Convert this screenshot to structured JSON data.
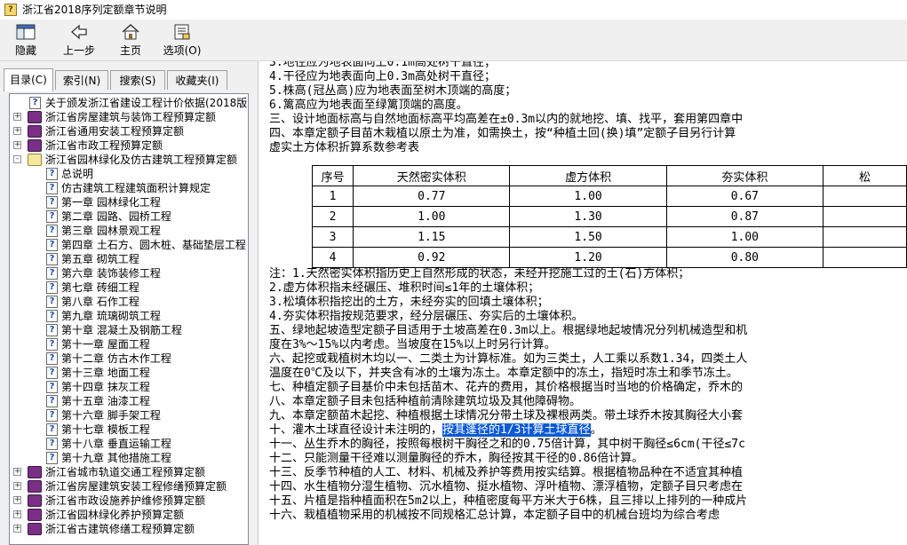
{
  "window": {
    "title": "浙江省2018序列定额章节说明",
    "app_icon": "help-file-icon"
  },
  "toolbar": {
    "buttons": [
      {
        "label": "隐藏",
        "icon": "hide-pane-icon"
      },
      {
        "label": "上一步",
        "icon": "back-arrow-icon"
      },
      {
        "label": "主页",
        "icon": "home-icon"
      },
      {
        "label": "选项(O)",
        "icon": "options-icon"
      }
    ]
  },
  "tabs": [
    "目录(C)",
    "索引(N)",
    "搜索(S)",
    "收藏夹(I)"
  ],
  "tree": [
    {
      "label": "关于颁发浙江省建设工程计价依据(2018版)",
      "type": "page"
    },
    {
      "label": "浙江省房屋建筑与装饰工程预算定额",
      "type": "book",
      "expander": "+"
    },
    {
      "label": "浙江省通用安装工程预算定额",
      "type": "book",
      "expander": "+"
    },
    {
      "label": "浙江省市政工程预算定额",
      "type": "book",
      "expander": "+"
    },
    {
      "label": "浙江省园林绿化及仿古建筑工程预算定额",
      "type": "book-open",
      "expander": "-"
    },
    {
      "label": "总说明",
      "type": "page",
      "child": true
    },
    {
      "label": "仿古建筑工程建筑面积计算规定",
      "type": "page",
      "child": true
    },
    {
      "label": "第一章 园林绿化工程",
      "type": "page",
      "child": true
    },
    {
      "label": "第二章 园路、园桥工程",
      "type": "page",
      "child": true
    },
    {
      "label": "第三章 园林景观工程",
      "type": "page",
      "child": true
    },
    {
      "label": "第四章 土石方、圆木桩、基础垫层工程",
      "type": "page",
      "child": true
    },
    {
      "label": "第五章 砌筑工程",
      "type": "page",
      "child": true
    },
    {
      "label": "第六章 装饰装修工程",
      "type": "page",
      "child": true
    },
    {
      "label": "第七章 砖细工程",
      "type": "page",
      "child": true
    },
    {
      "label": "第八章 石作工程",
      "type": "page",
      "child": true
    },
    {
      "label": "第九章 琉璃砌筑工程",
      "type": "page",
      "child": true
    },
    {
      "label": "第十章 混凝土及钢筋工程",
      "type": "page",
      "child": true
    },
    {
      "label": "第十一章 屋面工程",
      "type": "page",
      "child": true
    },
    {
      "label": "第十二章 仿古木作工程",
      "type": "page",
      "child": true
    },
    {
      "label": "第十三章 地面工程",
      "type": "page",
      "child": true
    },
    {
      "label": "第十四章 抹灰工程",
      "type": "page",
      "child": true
    },
    {
      "label": "第十五章 油漆工程",
      "type": "page",
      "child": true
    },
    {
      "label": "第十六章 脚手架工程",
      "type": "page",
      "child": true
    },
    {
      "label": "第十七章 模板工程",
      "type": "page",
      "child": true
    },
    {
      "label": "第十八章 垂直运输工程",
      "type": "page",
      "child": true
    },
    {
      "label": "第十九章 其他措施工程",
      "type": "page",
      "child": true
    },
    {
      "label": "浙江省城市轨道交通工程预算定额",
      "type": "book",
      "expander": "+"
    },
    {
      "label": "浙江省房屋建筑安装工程修缮预算定额",
      "type": "book",
      "expander": "+"
    },
    {
      "label": "浙江省市政设施养护维修预算定额",
      "type": "book",
      "expander": "+"
    },
    {
      "label": "浙江省园林绿化养护预算定额",
      "type": "book",
      "expander": "+"
    },
    {
      "label": "浙江省古建筑修缮工程预算定额",
      "type": "book",
      "expander": "+"
    }
  ],
  "content": {
    "lines_top": [
      "  3.地径应为地表面向上0.1m高处树干直径；",
      "  4.干径应为地表面向上0.3m高处树干直径；",
      "  5.株高(冠丛高)应为地表面至树木顶端的高度；",
      "  6.篱高应为地表面至绿篱顶端的高度。",
      "  三、设计地面标高与自然地面标高平均高差在±0.3m以内的就地挖、填、找平，套用第四章中",
      "  四、本章定额子目苗木栽植以原土为准，如需换土，按“种植土回(换)填”定额子目另行计算",
      "  虚实土方体积折算系数参考表"
    ],
    "table": {
      "headers": [
        "序号",
        "天然密实体积",
        "虚方体积",
        "夯实体积",
        "松"
      ],
      "rows": [
        [
          "1",
          "0.77",
          "1.00",
          "0.67",
          ""
        ],
        [
          "2",
          "1.00",
          "1.30",
          "0.87",
          ""
        ],
        [
          "3",
          "1.15",
          "1.50",
          "1.00",
          ""
        ],
        [
          "4",
          "0.92",
          "1.20",
          "0.80",
          ""
        ]
      ]
    },
    "lines_bottom": [
      "  注：1.天然密实体积指历史上自然形成的状态，未经开挖施工过的土(石)方体积；",
      "  2.虚方体积指未经碾压、堆积时间≤1年的土壤体积；",
      "  3.松填体积指挖出的土方，未经夯实的回填土壤体积；",
      "  4.夯实体积指按规范要求，经分层碾压、夯实后的土壤体积。",
      "  五、绿地起坡造型定额子目适用于土坡高差在0.3m以上。根据绿地起坡情况分列机械造型和机",
      "度在3%～15%以内考虑。当坡度在15%以上时另行计算。",
      "  六、起挖或栽植树木均以一、二类土为计算标准。如为三类土，人工乘以系数1.34，四类土人",
      "  温度在0℃及以下，并夹含有冰的土壤为冻土。本章定额中的冻土，指短时冻土和季节冻土。",
      "  七、种植定额子目基价中未包括苗木、花卉的费用，其价格根据当时当地的价格确定，乔木的",
      "  八、本章定额子目未包括种植前清除建筑垃圾及其他障碍物。",
      "  九、本章定额苗木起挖、种植根据土球情况分带土球及裸根两类。带土球乔木按其胸径大小套"
    ],
    "line_highlight": {
      "before": "  十、灌木土球直径设计未注明的，",
      "highlighted": "按其蓬径的1/3计算土球直径",
      "after": "。"
    },
    "lines_end": [
      "  十一、丛生乔木的胸径，按照每根树干胸径之和的0.75倍计算，其中树干胸径≤6cm(干径≤7c",
      "  十二、只能测量干径难以测量胸径的乔木，胸径按其干径的0.86倍计算。",
      "  十三、反季节种植的人工、材料、机械及养护等费用按实结算。根据植物品种在不适宜其种植",
      "  十四、水生植物分湿生植物、沉水植物、挺水植物、浮叶植物、漂浮植物，定额子目只考虑在",
      "  十五、片植是指种植面积在5m2以上，种植密度每平方米大于6株，且三排以上排列的一种成片",
      "  十六、栽植植物采用的机械按不同规格汇总计算，本定额子目中的机械台班均为综合考虑"
    ]
  },
  "colors": {
    "selection": "#0a5ad6",
    "book": "#7a2f86",
    "toolbar_bg": "#f0f0f0"
  }
}
